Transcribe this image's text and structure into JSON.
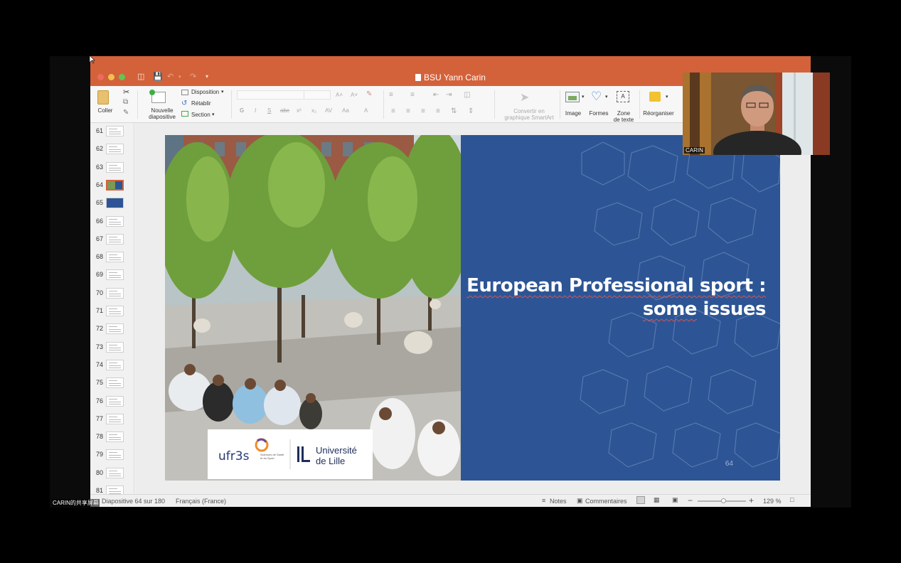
{
  "window": {
    "title": "BSU Yann Carin"
  },
  "ribbon": {
    "paste": "Coller",
    "new_slide": "Nouvelle\ndiapositive",
    "layout": "Disposition",
    "reset": "Rétablir",
    "section": "Section",
    "convert_smartart": "Convertir en\ngraphique SmartArt",
    "image": "Image",
    "shapes": "Formes",
    "textbox": "Zone\nde texte",
    "arrange": "Réorganiser"
  },
  "thumbnails": [
    {
      "num": "61"
    },
    {
      "num": "62"
    },
    {
      "num": "63"
    },
    {
      "num": "64",
      "selected": true
    },
    {
      "num": "65"
    },
    {
      "num": "66"
    },
    {
      "num": "67"
    },
    {
      "num": "68"
    },
    {
      "num": "69"
    },
    {
      "num": "70"
    },
    {
      "num": "71"
    },
    {
      "num": "72"
    },
    {
      "num": "73"
    },
    {
      "num": "74"
    },
    {
      "num": "75"
    },
    {
      "num": "76"
    },
    {
      "num": "77"
    },
    {
      "num": "78"
    },
    {
      "num": "79"
    },
    {
      "num": "80"
    },
    {
      "num": "81"
    }
  ],
  "slide": {
    "title_line1": "European Professional sport :",
    "title_line2_prefix": "some",
    "title_line2_rest": " issues",
    "number": "64",
    "logo_ufr": "ufr3s",
    "logo_ufr_sub": "Sciences de Santé\net du Sport",
    "logo_univ_line1": "Université",
    "logo_univ_line2": "de Lille"
  },
  "webcam": {
    "label": "CARIN"
  },
  "statusbar": {
    "slide_info": "Diapositive 64 sur 180",
    "language": "Français (France)",
    "notes": "Notes",
    "comments": "Commentaires",
    "zoom": "129 %"
  },
  "share_label": "CARIN的共享屏幕",
  "colors": {
    "titlebar": "#d3623a",
    "slide_blue": "#2d5595"
  }
}
